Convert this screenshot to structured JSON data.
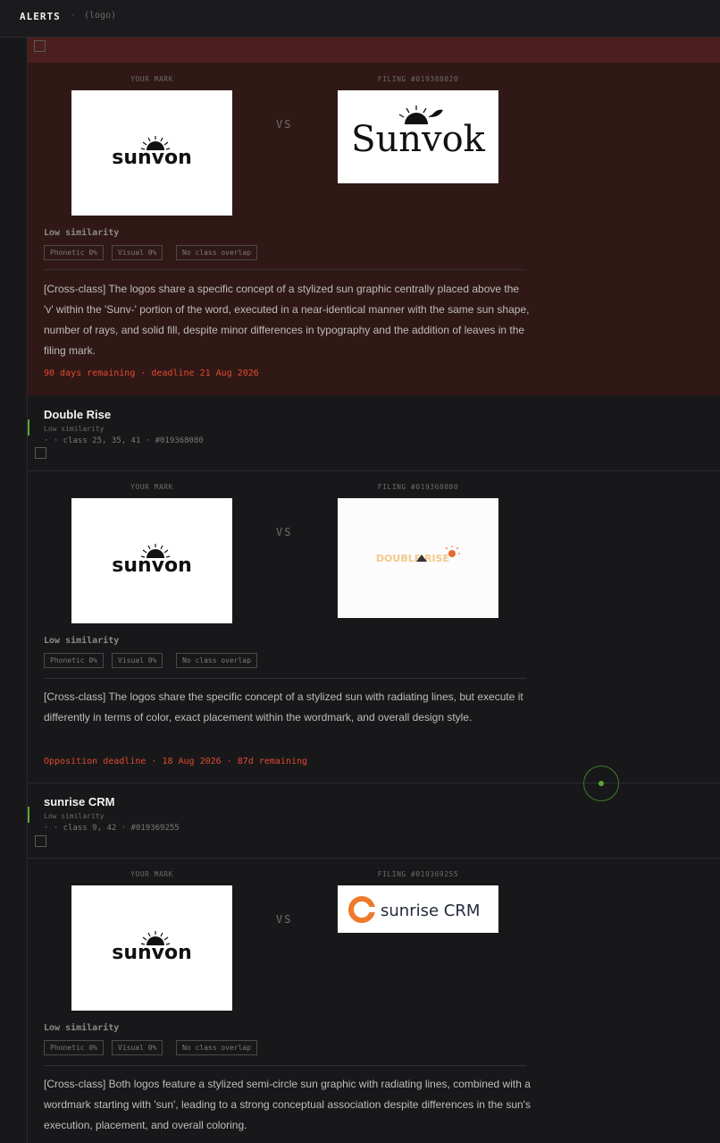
{
  "header": {
    "title": "ALERTS",
    "separator": "·",
    "logo_text": "(logo)"
  },
  "labels": {
    "your_mark": "YOUR MARK",
    "vs": "VS"
  },
  "your_mark": {
    "brand": "sunvon"
  },
  "colors": {
    "accent_green": "#5aa832",
    "deadline_red": "#e04a2e",
    "first_alert_bg": "#301816",
    "first_alert_band": "#4b1f1d"
  },
  "alerts": [
    {
      "filing_label": "FILING #019388020",
      "filing_brand": "Sunvok",
      "similarity": "Low similarity",
      "chips": [
        "Phonetic 0%",
        "Visual 0%",
        "No class overlap"
      ],
      "description": "[Cross-class] The logos share a specific concept of a stylized sun graphic centrally placed above the 'v' within the 'Sunv-' portion of the word, executed in a near-identical manner with the same sun shape, number of rays, and solid fill, despite minor differences in typography and the addition of leaves in the filing mark.",
      "deadline": "90 days remaining · deadline 21 Aug 2026"
    },
    {
      "title": "Double Rise",
      "sim_small": "Low similarity",
      "meta": "· · class 25, 35, 41 · #019368080",
      "filing_label": "FILING #019368080",
      "filing_brand": "DOUBLE RISE",
      "similarity": "Low similarity",
      "chips": [
        "Phonetic 0%",
        "Visual 0%",
        "No class overlap"
      ],
      "description": "[Cross-class] The logos share the specific concept of a stylized sun with radiating lines, but execute it differently in terms of color, exact placement within the wordmark, and overall design style.",
      "deadline": "Opposition deadline · 18 Aug 2026 · 87d remaining"
    },
    {
      "title": "sunrise CRM",
      "sim_small": "Low similarity",
      "meta": "· · class 9, 42 · #019369255",
      "filing_label": "FILING #019369255",
      "filing_brand": "sunrise CRM",
      "similarity": "Low similarity",
      "chips": [
        "Phonetic 0%",
        "Visual 0%",
        "No class overlap"
      ],
      "description": "[Cross-class] Both logos feature a stylized semi-circle sun graphic with radiating lines, combined with a wordmark starting with 'sun', leading to a strong conceptual association despite differences in the sun's execution, placement, and overall coloring."
    }
  ]
}
